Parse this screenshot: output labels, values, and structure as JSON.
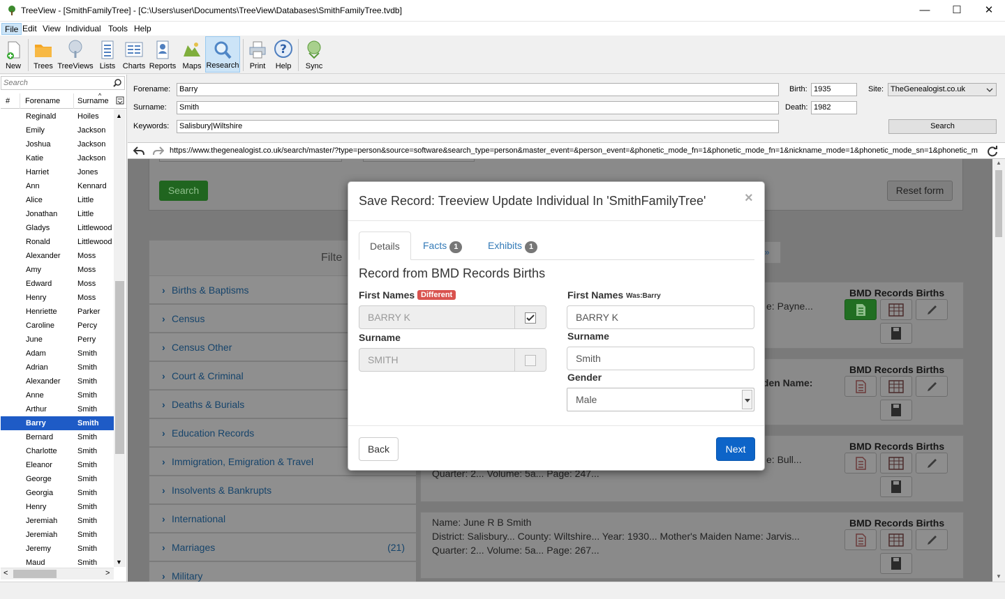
{
  "window": {
    "title": "TreeView - [SmithFamilyTree] - [C:\\Users\\user\\Documents\\TreeView\\Databases\\SmithFamilyTree.tvdb]",
    "minimize": "—",
    "maximize": "☐",
    "close": "✕"
  },
  "menu": [
    "File",
    "Edit",
    "View",
    "Individual",
    "Tools",
    "Help"
  ],
  "toolbar": {
    "new": "New",
    "trees": "Trees",
    "treeviews": "TreeViews",
    "lists": "Lists",
    "charts": "Charts",
    "reports": "Reports",
    "maps": "Maps",
    "research": "Research",
    "print": "Print",
    "help": "Help",
    "sync": "Sync"
  },
  "left": {
    "search_placeholder": "Search",
    "col_num": "#",
    "col_forename": "Forename",
    "col_surname": "Surname",
    "people": [
      {
        "f": "Reginald",
        "s": "Hoiles"
      },
      {
        "f": "Emily",
        "s": "Jackson"
      },
      {
        "f": "Joshua",
        "s": "Jackson"
      },
      {
        "f": "Katie",
        "s": "Jackson"
      },
      {
        "f": "Harriet",
        "s": "Jones"
      },
      {
        "f": "Ann",
        "s": "Kennard"
      },
      {
        "f": "Alice",
        "s": "Little"
      },
      {
        "f": "Jonathan",
        "s": "Little"
      },
      {
        "f": "Gladys",
        "s": "Littlewood"
      },
      {
        "f": "Ronald",
        "s": "Littlewood"
      },
      {
        "f": "Alexander",
        "s": "Moss"
      },
      {
        "f": "Amy",
        "s": "Moss"
      },
      {
        "f": "Edward",
        "s": "Moss"
      },
      {
        "f": "Henry",
        "s": "Moss"
      },
      {
        "f": "Henriette",
        "s": "Parker"
      },
      {
        "f": "Caroline",
        "s": "Percy"
      },
      {
        "f": "June",
        "s": "Perry"
      },
      {
        "f": "Adam",
        "s": "Smith"
      },
      {
        "f": "Adrian",
        "s": "Smith"
      },
      {
        "f": "Alexander",
        "s": "Smith"
      },
      {
        "f": "Anne",
        "s": "Smith"
      },
      {
        "f": "Arthur",
        "s": "Smith"
      },
      {
        "f": "Barry",
        "s": "Smith"
      },
      {
        "f": "Bernard",
        "s": "Smith"
      },
      {
        "f": "Charlotte",
        "s": "Smith"
      },
      {
        "f": "Eleanor",
        "s": "Smith"
      },
      {
        "f": "George",
        "s": "Smith"
      },
      {
        "f": "Georgia",
        "s": "Smith"
      },
      {
        "f": "Henry",
        "s": "Smith"
      },
      {
        "f": "Jeremiah",
        "s": "Smith"
      },
      {
        "f": "Jeremiah",
        "s": "Smith"
      },
      {
        "f": "Jeremy",
        "s": "Smith"
      },
      {
        "f": "Maud",
        "s": "Smith"
      }
    ],
    "selected_index": 22
  },
  "form": {
    "forename_label": "Forename:",
    "forename": "Barry",
    "surname_label": "Surname:",
    "surname": "Smith",
    "keywords_label": "Keywords:",
    "keywords": "Salisbury|Wiltshire",
    "birth_label": "Birth:",
    "birth": "1935",
    "death_label": "Death:",
    "death": "1982",
    "site_label": "Site:",
    "site": "TheGenealogist.co.uk",
    "search_button": "Search"
  },
  "url": "https://www.thegenealogist.co.uk/search/master/?type=person&source=software&search_type=person&master_event=&person_event=&phonetic_mode_fn=1&phonetic_mode_fn=1&nickname_mode=1&phonetic_mode_sn=1&phonetic_m",
  "web": {
    "search_button": "Search",
    "reset_button": "Reset form",
    "filter_label": "Filte",
    "page_next": "»",
    "categories": [
      {
        "label": "Births & Baptisms",
        "count": ""
      },
      {
        "label": "Census",
        "count": ""
      },
      {
        "label": "Census Other",
        "count": ""
      },
      {
        "label": "Court & Criminal",
        "count": ""
      },
      {
        "label": "Deaths & Burials",
        "count": ""
      },
      {
        "label": "Education Records",
        "count": ""
      },
      {
        "label": "Immigration, Emigration & Travel",
        "count": ""
      },
      {
        "label": "Insolvents & Bankrupts",
        "count": ""
      },
      {
        "label": "International",
        "count": ""
      },
      {
        "label": "Marriages",
        "count": "(21)"
      },
      {
        "label": "Military",
        "count": ""
      }
    ],
    "results": [
      {
        "heading": "BMD Records Births",
        "snippet": "e: Payne..."
      },
      {
        "heading": "BMD Records Births",
        "snippet": "iden Name:"
      },
      {
        "heading": "BMD Records Births",
        "snippet": "e: Bull...",
        "line2": "Quarter: 2... Volume: 5a... Page: 247..."
      },
      {
        "heading": "BMD Records Births",
        "name": "Name: June R B Smith",
        "line1": "District: Salisbury... County: Wiltshire... Year: 1930... Mother's Maiden Name: Jarvis...",
        "line2": "Quarter: 2... Volume: 5a... Page: 267..."
      }
    ]
  },
  "modal": {
    "title": "Save Record: Treeview Update Individual In 'SmithFamilyTree'",
    "close": "×",
    "tabs": [
      {
        "label": "Details",
        "badge": ""
      },
      {
        "label": "Facts",
        "badge": "1"
      },
      {
        "label": "Exhibits",
        "badge": "1"
      }
    ],
    "heading": "Record from BMD Records Births",
    "left_first_names_label": "First Names",
    "different_badge": "Different",
    "left_first_names_value": "BARRY K",
    "left_surname_label": "Surname",
    "left_surname_value": "SMITH",
    "right_first_names_label": "First Names",
    "was_note": "Was:Barry",
    "right_first_names_value": "BARRY K",
    "right_surname_label": "Surname",
    "right_surname_value": "Smith",
    "gender_label": "Gender",
    "gender_value": "Male",
    "back_button": "Back",
    "next_button": "Next",
    "colors": {
      "primary": "#0d64c8",
      "danger": "#d9534f",
      "badge": "#777777"
    }
  }
}
